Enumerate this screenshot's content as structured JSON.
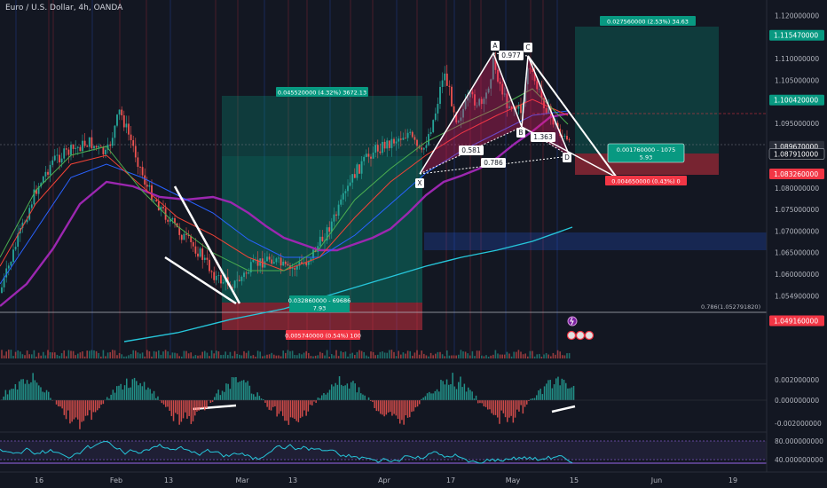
{
  "header": {
    "symbol_title": "Euro / U.S. Dollar, 4h, OANDA"
  },
  "chart_data": {
    "type": "candlestick",
    "symbol": "Euro / U.S. Dollar, 4h, OANDA",
    "price_axis": {
      "min": 1.047,
      "max": 1.122,
      "ticks": [
        "1.120000000",
        "1.115470000",
        "1.110000000",
        "1.105000000",
        "1.100420000",
        "1.095000000",
        "1.089670000",
        "1.087910000",
        "1.083260000",
        "1.080000000",
        "1.075000000",
        "1.070000000",
        "1.065000000",
        "1.060000000",
        "1.054900000",
        "1.049160000"
      ]
    },
    "highlighted_prices": [
      {
        "label": "1.115470000",
        "color": "#089981"
      },
      {
        "label": "1.100420000",
        "color": "#089981"
      },
      {
        "label": "1.089670000",
        "color": "#2a2e39",
        "sublabel": "02:56:49"
      },
      {
        "label": "1.087910000",
        "color": "#131722"
      },
      {
        "label": "1.083260000",
        "color": "#f23645"
      },
      {
        "label": "1.049160000",
        "color": "#f23645"
      }
    ],
    "time_axis": [
      "16",
      "Feb",
      "13",
      "Mar",
      "13",
      "Apr",
      "17",
      "May",
      "15",
      "Jun",
      "19"
    ],
    "pattern": {
      "points": [
        "X",
        "A",
        "B",
        "C",
        "D"
      ],
      "ratios": [
        "0.581",
        "0.977",
        "1.363",
        "0.786"
      ]
    },
    "positions": [
      {
        "target_label": "0.045520000 (4.32%) 3672.13",
        "stop_label": "0.005740000 (0.54%) 100",
        "entry_label_1": "0.032860000 - 69686",
        "entry_label_2": "7.93"
      },
      {
        "target_label": "0.027560000 (2.53%) 34.63",
        "stop_label": "0.004650000 (0.43%) 0",
        "entry_label_1": "0.001760000 - 1075",
        "entry_label_2": "5.93"
      }
    ],
    "fib_label": "0.786(1.052791820)",
    "macd_axis": [
      "0.002000000",
      "0.000000000",
      "-0.002000000"
    ],
    "rsi_axis": [
      "80.000000000",
      "40.000000000"
    ],
    "colors": {
      "bull": "#26a69a",
      "bear": "#ef5350",
      "ma_purple": "#9c27b0",
      "ma_cyan": "#26c6da",
      "pattern_fill": "#e91e63"
    }
  }
}
